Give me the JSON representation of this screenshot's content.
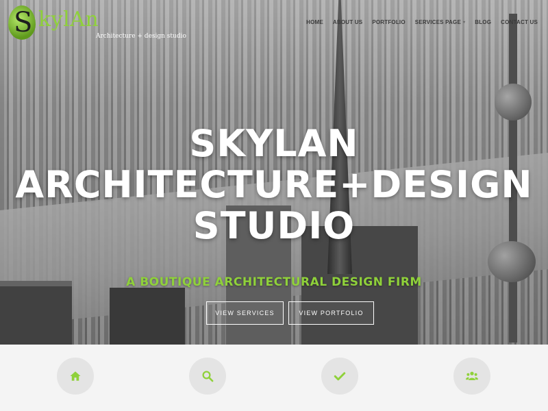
{
  "logo": {
    "brand_initial": "S",
    "brand_text": "kylAn",
    "tagline": "Architecture + design studio",
    "icon": "leaf-s-logo"
  },
  "nav": {
    "items": [
      {
        "label": "HOME"
      },
      {
        "label": "ABOUT US"
      },
      {
        "label": "PORTFOLIO"
      },
      {
        "label": "SERVICES PAGE",
        "has_dropdown": true
      },
      {
        "label": "BLOG"
      },
      {
        "label": "CONTACT US"
      }
    ]
  },
  "hero": {
    "title_lines": [
      "SKYLAN",
      "ARCHITECTURE+DESIGN",
      "STUDIO"
    ],
    "subtitle": "A BOUTIQUE ARCHITECTURAL DESIGN FIRM",
    "buttons": {
      "services": "VIEW SERVICES",
      "portfolio": "VIEW PORTFOLIO"
    }
  },
  "features": {
    "icons": [
      "home-icon",
      "search-icon",
      "checkmark-icon",
      "users-icon"
    ]
  },
  "colors": {
    "accent": "#8fd13a",
    "nav_text": "#3b3b3b",
    "feature_circle": "#e4e4e4"
  }
}
